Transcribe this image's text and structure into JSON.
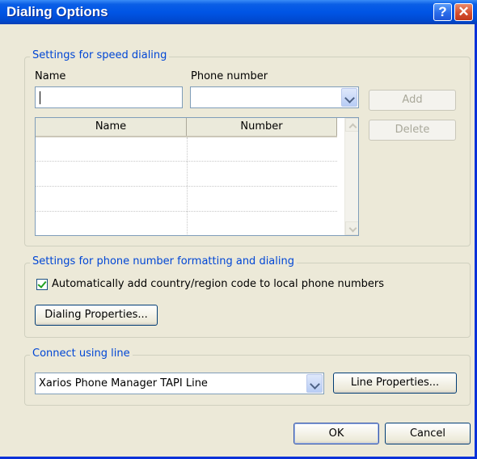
{
  "window": {
    "title": "Dialing Options",
    "help_glyph": "?",
    "close_glyph": "✕"
  },
  "speed_dial": {
    "legend": "Settings for speed dialing",
    "name_label": "Name",
    "phone_label": "Phone number",
    "name_value": "",
    "phone_value": "",
    "add_label": "Add",
    "delete_label": "Delete",
    "table": {
      "columns": [
        "Name",
        "Number"
      ],
      "rows": []
    }
  },
  "formatting": {
    "legend": "Settings for phone number formatting and dialing",
    "auto_country_label": "Automatically add country/region code to local phone numbers",
    "auto_country_checked": true,
    "dialing_properties_label": "Dialing Properties..."
  },
  "connect": {
    "legend": "Connect using line",
    "line_value": "Xarios Phone Manager TAPI Line",
    "line_properties_label": "Line Properties..."
  },
  "footer": {
    "ok_label": "OK",
    "cancel_label": "Cancel"
  }
}
